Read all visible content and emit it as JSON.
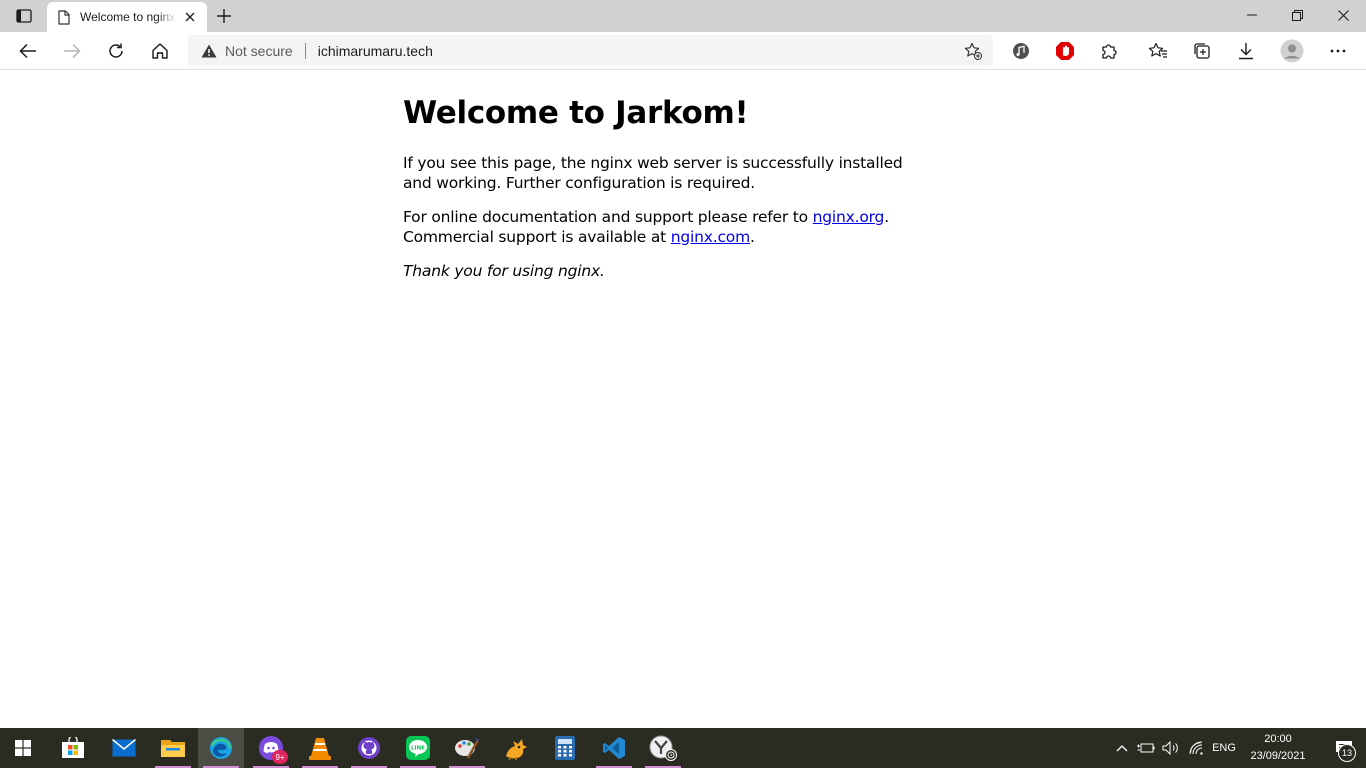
{
  "browser": {
    "tab": {
      "title": "Welcome to nginx!"
    },
    "address": {
      "security_label": "Not secure",
      "url": "ichimarumaru.tech"
    }
  },
  "page": {
    "heading": "Welcome to Jarkom!",
    "para1": "If you see this page, the nginx web server is successfully installed and working. Further configuration is required.",
    "para2_prefix": "For online documentation and support please refer to ",
    "link_org": "nginx.org",
    "para2_middle": ".",
    "para2_line2_prefix": "Commercial support is available at ",
    "link_com": "nginx.com",
    "para2_suffix": ".",
    "thanks": "Thank you for using nginx."
  },
  "taskbar": {
    "apps": [
      "start",
      "store",
      "mail",
      "file-explorer",
      "edge",
      "discord",
      "vlc",
      "github-desktop",
      "line",
      "paint-brush",
      "game-dragon",
      "calculator",
      "vscode",
      "sandbox-clock"
    ],
    "discord_badge": "9+",
    "language": "ENG",
    "time": "20:00",
    "date": "23/09/2021",
    "notification_count": "13"
  },
  "colors": {
    "link": "#0000ee",
    "taskbar": "#2a2c22",
    "titlebar": "#d1d1d1",
    "accent_underline": "#d08fd0"
  }
}
